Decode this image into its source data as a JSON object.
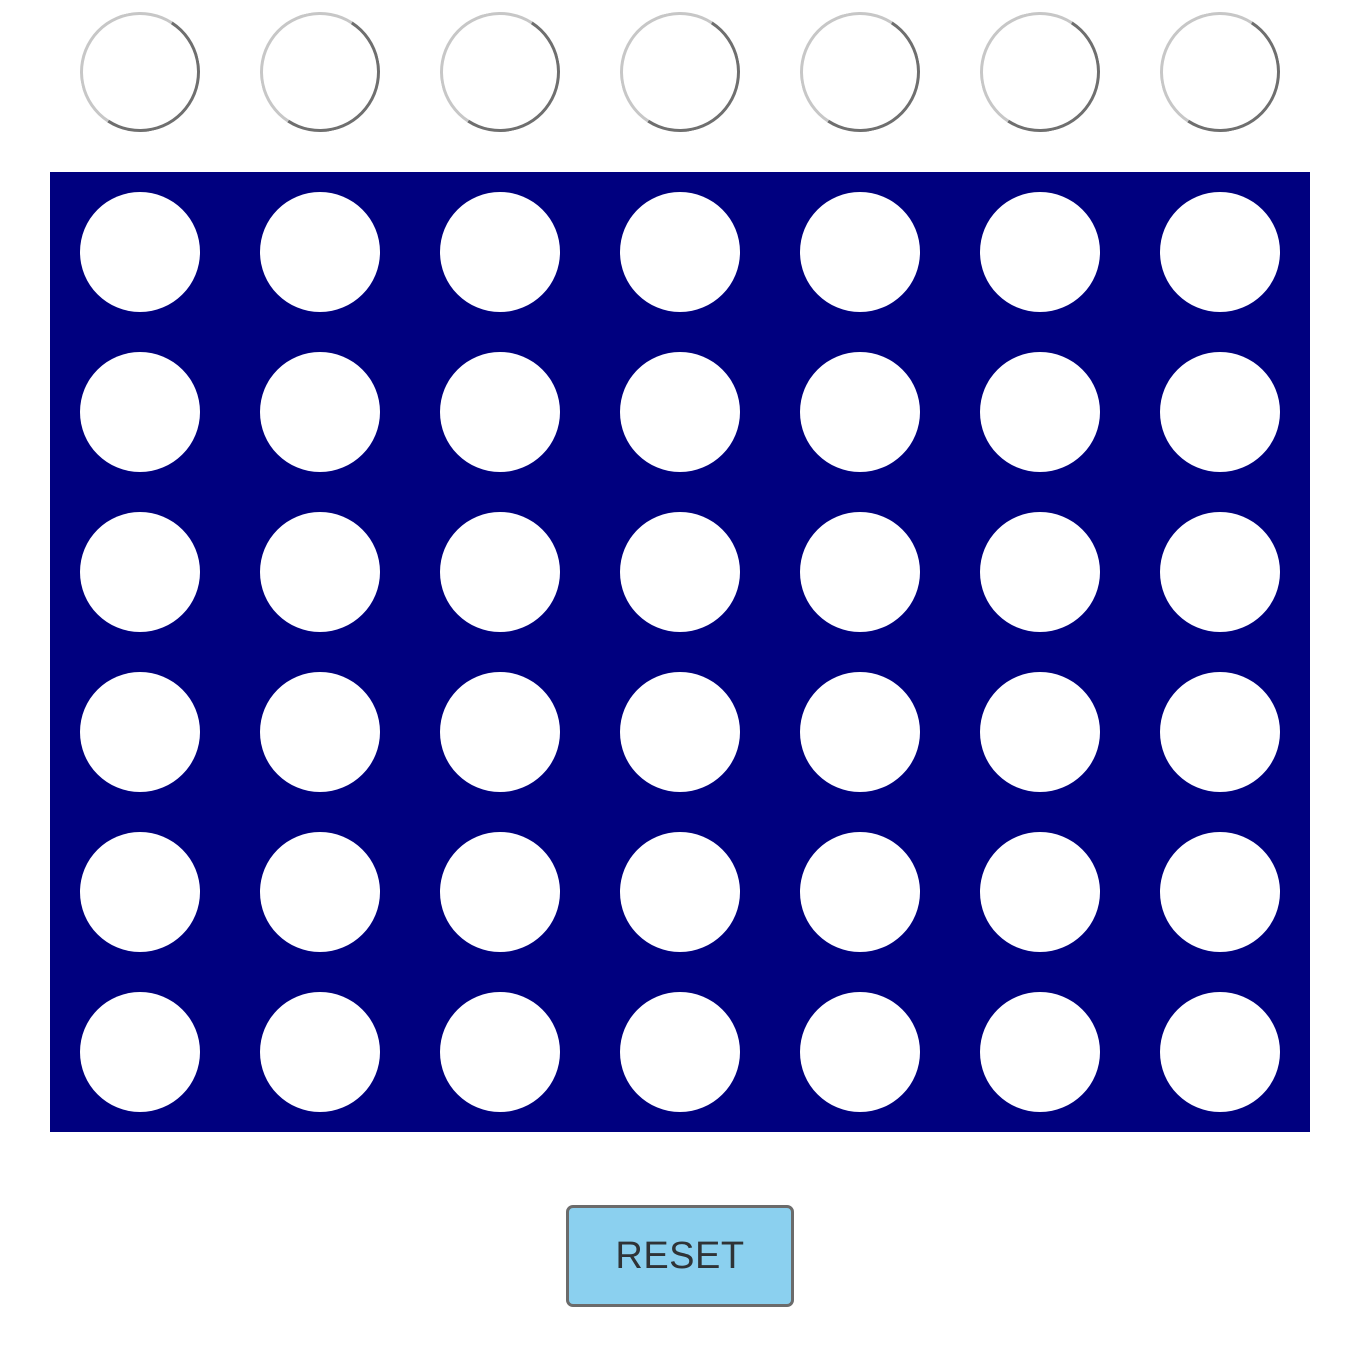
{
  "game": {
    "columns": 7,
    "rows": 6,
    "board_color": "#00007f",
    "empty_cell_color": "#ffffff",
    "slot_ring_light_color": "#c7c7c7",
    "slot_ring_dark_color": "#6f6f6f",
    "cells": [
      [
        "empty",
        "empty",
        "empty",
        "empty",
        "empty",
        "empty",
        "empty"
      ],
      [
        "empty",
        "empty",
        "empty",
        "empty",
        "empty",
        "empty",
        "empty"
      ],
      [
        "empty",
        "empty",
        "empty",
        "empty",
        "empty",
        "empty",
        "empty"
      ],
      [
        "empty",
        "empty",
        "empty",
        "empty",
        "empty",
        "empty",
        "empty"
      ],
      [
        "empty",
        "empty",
        "empty",
        "empty",
        "empty",
        "empty",
        "empty"
      ],
      [
        "empty",
        "empty",
        "empty",
        "empty",
        "empty",
        "empty",
        "empty"
      ]
    ]
  },
  "controls": {
    "reset_label": "RESET",
    "reset_color": "#8bd0ef"
  }
}
